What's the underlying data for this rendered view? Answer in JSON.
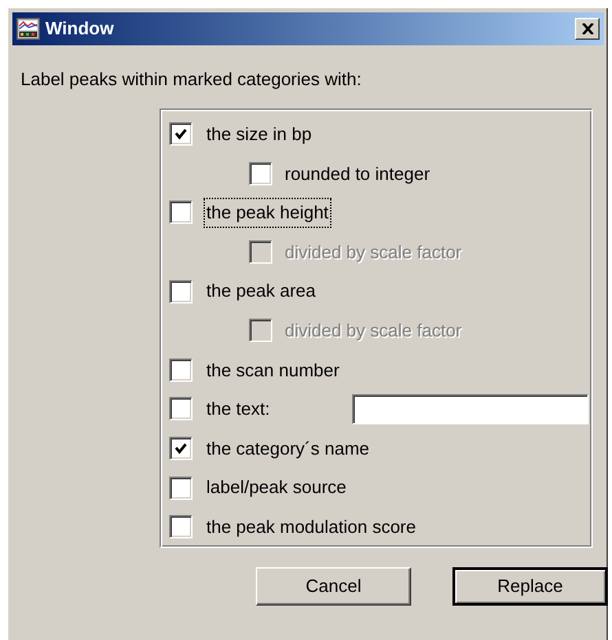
{
  "window": {
    "title": "Window"
  },
  "prompt": "Label peaks within marked categories with:",
  "options": [
    {
      "kind": "checkbox",
      "label": "the size in bp",
      "checked": true,
      "focused": false,
      "children": [
        {
          "label": "rounded to integer",
          "checked": false,
          "disabled": false
        }
      ]
    },
    {
      "kind": "checkbox",
      "label": "the peak height",
      "checked": false,
      "focused": true,
      "children": [
        {
          "label": "divided by scale factor",
          "checked": false,
          "disabled": true
        }
      ]
    },
    {
      "kind": "checkbox",
      "label": "the peak area",
      "checked": false,
      "focused": false,
      "children": [
        {
          "label": "divided by scale factor",
          "checked": false,
          "disabled": true
        }
      ]
    },
    {
      "kind": "checkbox",
      "label": "the scan number",
      "checked": false,
      "focused": false
    },
    {
      "kind": "text",
      "label": "the text:",
      "checked": false,
      "focused": false
    },
    {
      "kind": "checkbox",
      "label": "the category´s name",
      "checked": true,
      "focused": false
    },
    {
      "kind": "checkbox",
      "label": "label/peak source",
      "checked": false,
      "focused": false
    },
    {
      "kind": "checkbox",
      "label": "the peak modulation score",
      "checked": false,
      "focused": false
    }
  ],
  "buttons": [
    {
      "label": "Cancel",
      "default": false
    },
    {
      "label": "Replace",
      "default": true
    }
  ]
}
